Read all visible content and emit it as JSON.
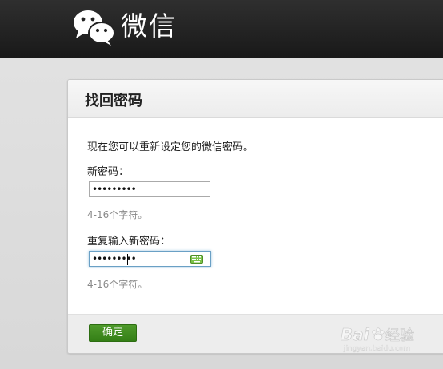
{
  "header": {
    "brand_name": "微信",
    "logo_icon": "wechat-logo-icon"
  },
  "card": {
    "title": "找回密码",
    "intro": "现在您可以重新设定您的微信密码。",
    "new_password": {
      "label": "新密码：",
      "masked_value": "•••••••••",
      "hint": "4-16个字符。"
    },
    "repeat_password": {
      "label": "重复输入新密码：",
      "masked_value": "•••••••••",
      "hint": "4-16个字符。",
      "keyboard_icon": "soft-keyboard-icon"
    },
    "submit_label": "确定"
  },
  "watermark": {
    "text": "Baidu 经验",
    "url_text": "jingyan.baidu.com"
  },
  "colors": {
    "header_bg": "#222222",
    "button_green": "#3d8a1e",
    "focus_border": "#6aa0c5",
    "hint_gray": "#8a8a8a"
  }
}
